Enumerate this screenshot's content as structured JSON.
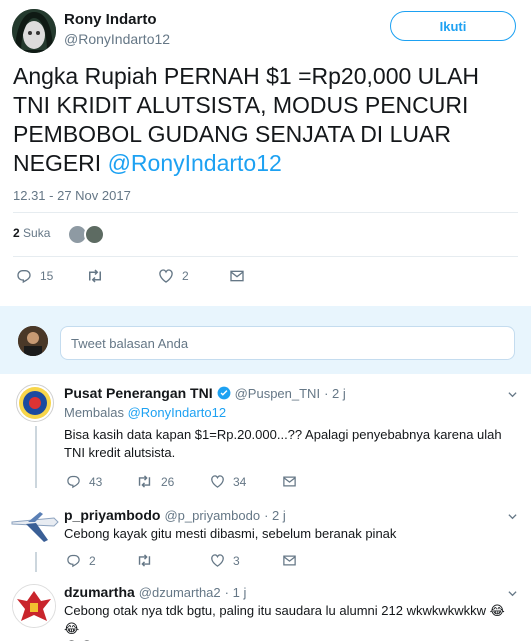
{
  "author": {
    "name": "Rony Indarto",
    "handle": "@RonyIndarto12",
    "follow_label": "Ikuti"
  },
  "tweet": {
    "text": "Angka Rupiah PERNAH $1 =Rp20,000 ULAH TNI KRIDIT ALUTSISTA, MODUS PENCURI PEMBOBOL GUDANG SENJATA DI LUAR NEGERI ",
    "mention": "@RonyIndarto12",
    "timestamp": "12.31 - 27 Nov 2017",
    "likes_count": "2",
    "likes_label": "Suka",
    "actions": {
      "reply_count": "15",
      "retweet_count": "",
      "like_count": "2"
    }
  },
  "reply_box": {
    "placeholder": "Tweet balasan Anda"
  },
  "replies": [
    {
      "name": "Pusat Penerangan TNI",
      "verified": true,
      "handle": "@Puspen_TNI",
      "time": "· 2 j",
      "replying_to_label": "Membalas",
      "replying_to": "@RonyIndarto12",
      "text": "Bisa kasih data kapan $1=Rp.20.000...?? Apalagi penyebabnya karena ulah TNI kredit alutsista.",
      "reply_count": "43",
      "retweet_count": "26",
      "like_count": "34"
    },
    {
      "name": "p_priyambodo",
      "handle": "@p_priyambodo",
      "time": "· 2 j",
      "text": "Cebong kayak gitu mesti dibasmi, sebelum beranak pinak",
      "reply_count": "2",
      "retweet_count": "",
      "like_count": "3"
    },
    {
      "name": "dzumartha",
      "handle": "@dzumartha2",
      "time": "· 1 j",
      "text": "Cebong otak nya tdk bgtu, paling itu saudara lu alumni 212 wkwkwkwkkw",
      "emoji": "😂😂",
      "emoji2": "😂😂"
    }
  ],
  "colors": {
    "accent": "#1da1f2",
    "muted": "#657786",
    "divider": "#e6ecf0",
    "like": "#e0245e",
    "retweet": "#17bf63"
  }
}
